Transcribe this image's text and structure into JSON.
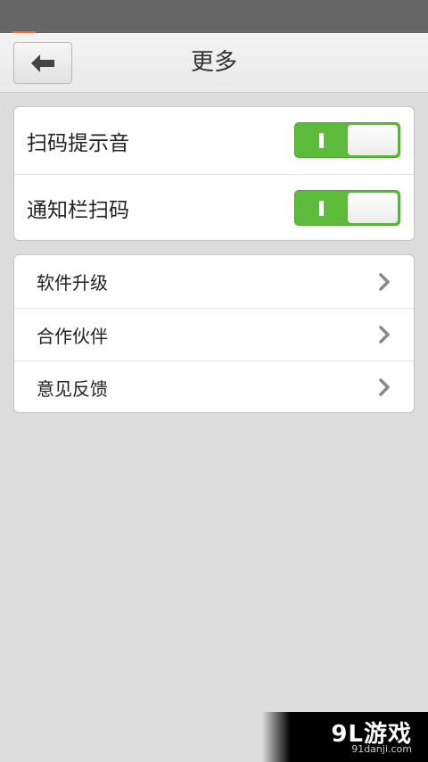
{
  "header": {
    "title": "更多",
    "back_icon": "arrow-left-icon"
  },
  "settings": {
    "toggles": [
      {
        "label": "扫码提示音",
        "on": true
      },
      {
        "label": "通知栏扫码",
        "on": true
      }
    ],
    "links": [
      {
        "label": "软件升级"
      },
      {
        "label": "合作伙伴"
      },
      {
        "label": "意见反馈"
      }
    ]
  },
  "watermark": {
    "main": "9L游戏",
    "sub": "91danji.com"
  },
  "colors": {
    "toggle_on": "#5dbb3c",
    "status_bar": "#666666",
    "background": "#dcdcdc"
  }
}
